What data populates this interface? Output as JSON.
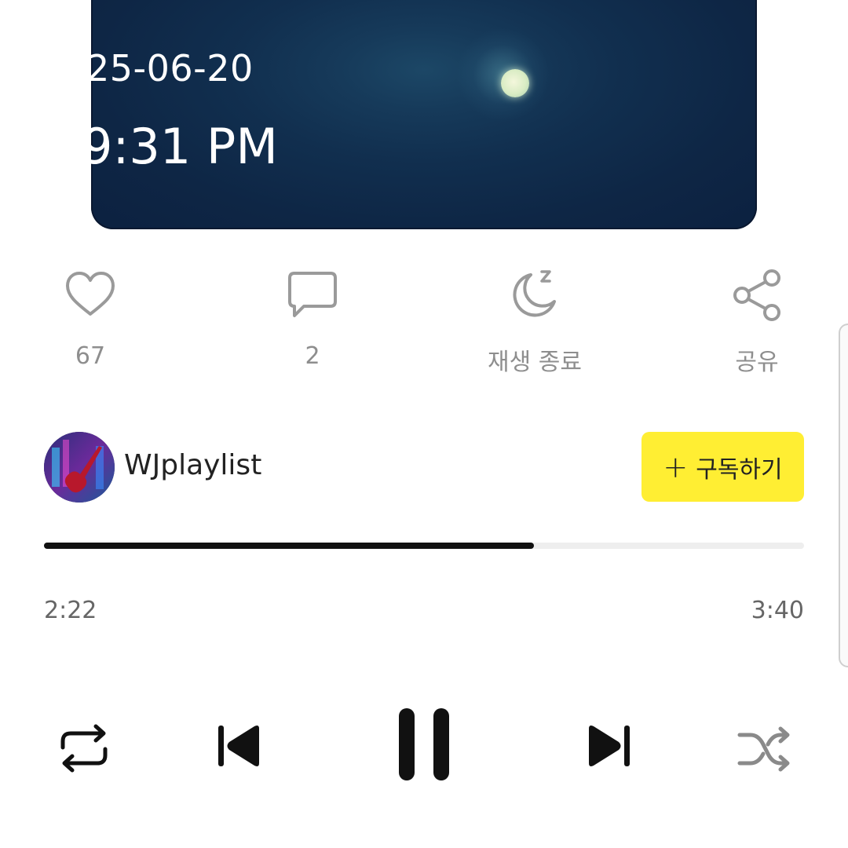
{
  "overlay": {
    "date": "25-06-20",
    "time": "9:31 PM"
  },
  "actions": {
    "like": {
      "icon": "heart-icon",
      "label": "67"
    },
    "comment": {
      "icon": "comment-icon",
      "label": "2"
    },
    "sleep_timer": {
      "icon": "moon-sleep-icon",
      "label": "재생 종료"
    },
    "share": {
      "icon": "share-icon",
      "label": "공유"
    }
  },
  "channel": {
    "name": "WJplaylist",
    "subscribe_label": "구독하기",
    "subscribe_color": "#ffee33"
  },
  "progress": {
    "elapsed": "2:22",
    "total": "3:40",
    "fraction": 0.645
  },
  "controls": {
    "repeat": "repeat-icon",
    "previous": "skip-previous-icon",
    "play_pause": "pause-icon",
    "next": "skip-next-icon",
    "shuffle": "shuffle-icon"
  }
}
